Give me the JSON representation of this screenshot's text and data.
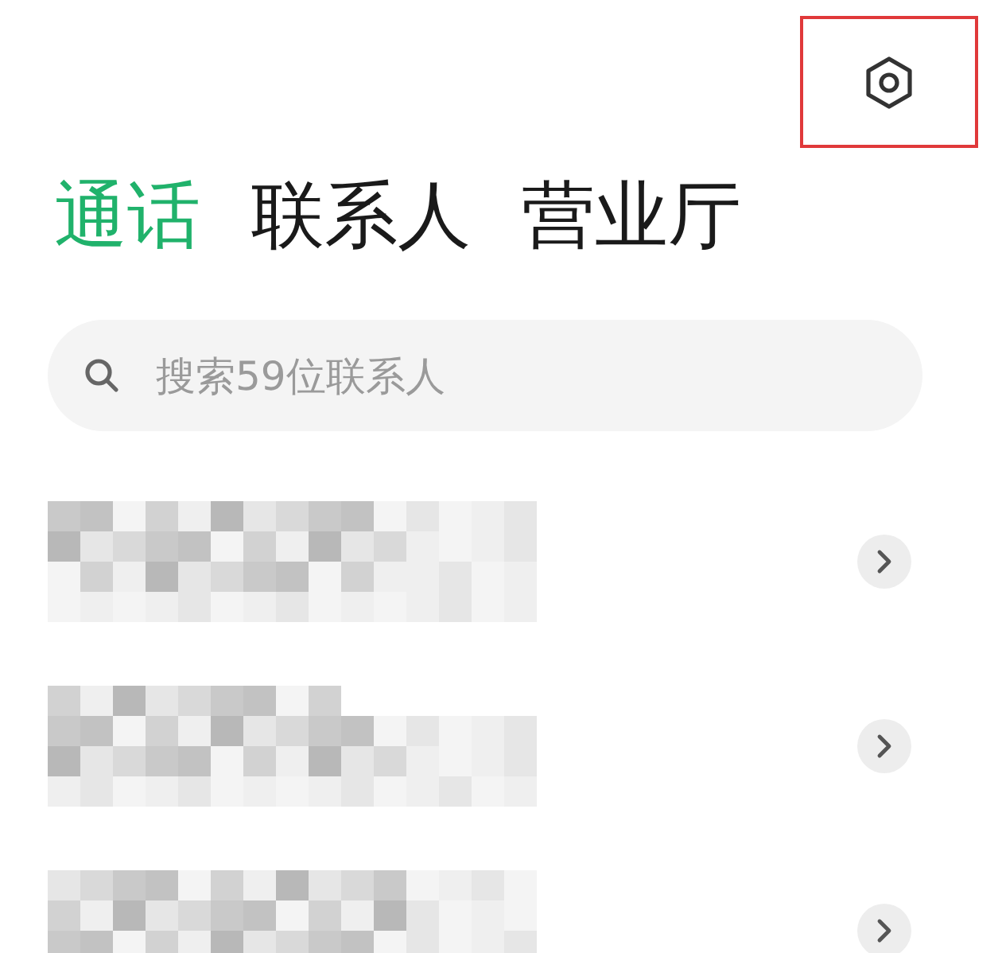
{
  "settings_button": {
    "highlighted": true
  },
  "tabs": [
    {
      "label": "通话",
      "selected": true
    },
    {
      "label": "联系人",
      "selected": false
    },
    {
      "label": "营业厅",
      "selected": false
    }
  ],
  "search": {
    "placeholder": "搜索59位联系人"
  },
  "rows": [
    {
      "kind": "redacted"
    },
    {
      "kind": "redacted"
    },
    {
      "kind": "redacted"
    }
  ]
}
